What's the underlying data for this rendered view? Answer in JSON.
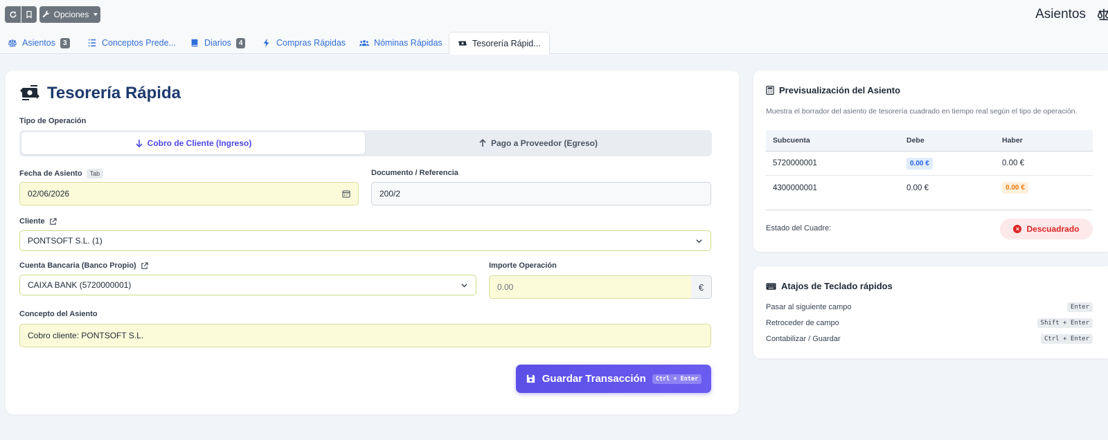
{
  "toolbar": {
    "options_label": "Opciones",
    "page_title": "Asientos"
  },
  "tabs": [
    {
      "label": "Asientos",
      "badge": "3",
      "icon": "scale-icon"
    },
    {
      "label": "Conceptos Prede...",
      "icon": "list-icon"
    },
    {
      "label": "Diarios",
      "badge": "4",
      "icon": "book-icon"
    },
    {
      "label": "Compras Rápidas",
      "icon": "bolt-icon"
    },
    {
      "label": "Nóminas Rápidas",
      "icon": "users-icon"
    },
    {
      "label": "Tesorería Rápid...",
      "icon": "money-transfer-icon",
      "active": true
    }
  ],
  "form": {
    "title": "Tesorería Rápida",
    "operation_type_label": "Tipo de Operación",
    "operation_options": [
      "Cobro de Cliente (Ingreso)",
      "Pago a Proveedor (Egreso)"
    ],
    "selected_operation": "Cobro de Cliente (Ingreso)",
    "date_label": "Fecha de Asiento",
    "date_hint": "Tab",
    "date_value": "02/06/2026",
    "document_label": "Documento / Referencia",
    "document_value": "200/2",
    "client_label": "Cliente",
    "client_value": "PONTSOFT S.L. (1)",
    "bank_label": "Cuenta Bancaria (Banco Propio)",
    "bank_value": "CAIXA BANK (5720000001)",
    "amount_label": "Importe Operación",
    "amount_value": "0.00",
    "currency": "€",
    "concept_label": "Concepto del Asiento",
    "concept_value": "Cobro cliente: PONTSOFT S.L.",
    "save_label": "Guardar Transacción",
    "save_shortcut": "Ctrl + Enter"
  },
  "preview": {
    "title": "Previsualización del Asiento",
    "description": "Muestra el borrador del asiento de tesorería cuadrado en tiempo real según el tipo de operación.",
    "columns": [
      "Subcuenta",
      "Debe",
      "Haber"
    ],
    "rows": [
      {
        "subcuenta": "5720000001",
        "debe": "0.00 €",
        "haber": "0.00 €"
      },
      {
        "subcuenta": "4300000001",
        "debe": "0.00 €",
        "haber": "0.00 €"
      }
    ],
    "status_label": "Estado del Cuadre:",
    "status_value": "Descuadrado"
  },
  "shortcuts": {
    "title": "Atajos de Teclado rápidos",
    "items": [
      {
        "label": "Pasar al siguiente campo",
        "key": "Enter"
      },
      {
        "label": "Retroceder de campo",
        "key": "Shift + Enter"
      },
      {
        "label": "Contabilizar / Guardar",
        "key": "Ctrl + Enter"
      }
    ]
  },
  "colors": {
    "accent": "#5b50e6",
    "link": "#2f6fd8",
    "title": "#1e3a6e",
    "danger": "#dc2626",
    "input_highlight": "#fbfbd9"
  }
}
